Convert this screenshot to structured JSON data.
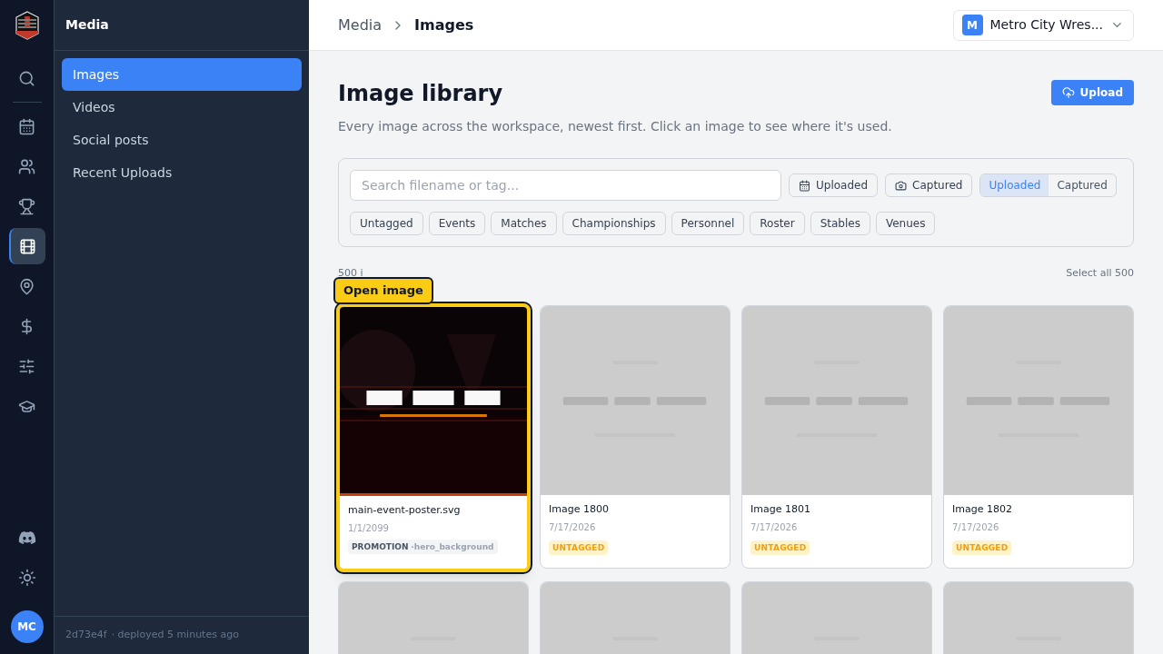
{
  "rail": {
    "items": [
      {
        "kind": "search",
        "selected": false
      },
      {
        "kind": "calendar",
        "selected": false
      },
      {
        "kind": "users",
        "selected": false
      },
      {
        "kind": "trophy",
        "selected": false
      },
      {
        "kind": "film",
        "selected": true
      },
      {
        "kind": "pin",
        "selected": false
      },
      {
        "kind": "dollar",
        "selected": false
      },
      {
        "kind": "sliders",
        "selected": false
      },
      {
        "kind": "cap",
        "selected": false
      }
    ],
    "bottom": [
      {
        "kind": "discord"
      },
      {
        "kind": "sun"
      }
    ],
    "avatar": "MC"
  },
  "sidebar": {
    "title": "Media",
    "items": [
      {
        "label": "Images",
        "selected": true
      },
      {
        "label": "Videos",
        "selected": false
      },
      {
        "label": "Social posts",
        "selected": false
      },
      {
        "label": "Recent Uploads",
        "selected": false
      }
    ],
    "footer": {
      "commit": "2d73e4f",
      "note": "· deployed 5 minutes ago"
    }
  },
  "breadcrumb": [
    "Media",
    "Images"
  ],
  "workspace": {
    "initial": "M",
    "name": "Metro City Wres..."
  },
  "page": {
    "title": "Image library",
    "upload": "Upload",
    "description": "Every image across the workspace, newest first. Click an image to see where it's used."
  },
  "filters": {
    "search_placeholder": "Search filename or tag...",
    "sort_buttons": [
      {
        "kind": "calendar",
        "label": "Uploaded"
      },
      {
        "kind": "camera",
        "label": "Captured"
      }
    ],
    "segments": [
      {
        "label": "Uploaded",
        "selected": true
      },
      {
        "label": "Captured",
        "selected": false
      }
    ],
    "tags": [
      {
        "label": "Untagged",
        "selected": false
      },
      {
        "label": "Events",
        "selected": false
      },
      {
        "label": "Matches",
        "selected": false
      },
      {
        "label": "Championships",
        "selected": false
      },
      {
        "label": "Personnel",
        "selected": false
      },
      {
        "label": "Roster",
        "selected": false
      },
      {
        "label": "Stables",
        "selected": false
      },
      {
        "label": "Venues",
        "selected": false
      }
    ]
  },
  "count": "500 i",
  "select_all": "Select all 500",
  "tooltip": "Open image",
  "images": [
    {
      "kind": "poster",
      "name": "main-event-poster.svg",
      "date": "1/1/2099",
      "focused": true,
      "tag": {
        "kind": "category",
        "label": "PROMOTION",
        "detail": "·hero_background"
      }
    },
    {
      "kind": "placeholder",
      "name": "Image 1800",
      "date": "7/17/2026",
      "focused": false,
      "tag": {
        "kind": "untagged",
        "label": "UNTAGGED"
      }
    },
    {
      "kind": "placeholder",
      "name": "Image 1801",
      "date": "7/17/2026",
      "focused": false,
      "tag": {
        "kind": "untagged",
        "label": "UNTAGGED"
      }
    },
    {
      "kind": "placeholder",
      "name": "Image 1802",
      "date": "7/17/2026",
      "focused": false,
      "tag": {
        "kind": "untagged",
        "label": "UNTAGGED"
      }
    },
    {
      "kind": "placeholder",
      "focused": false
    },
    {
      "kind": "placeholder",
      "focused": false
    },
    {
      "kind": "placeholder",
      "focused": false
    },
    {
      "kind": "placeholder",
      "focused": false
    }
  ]
}
